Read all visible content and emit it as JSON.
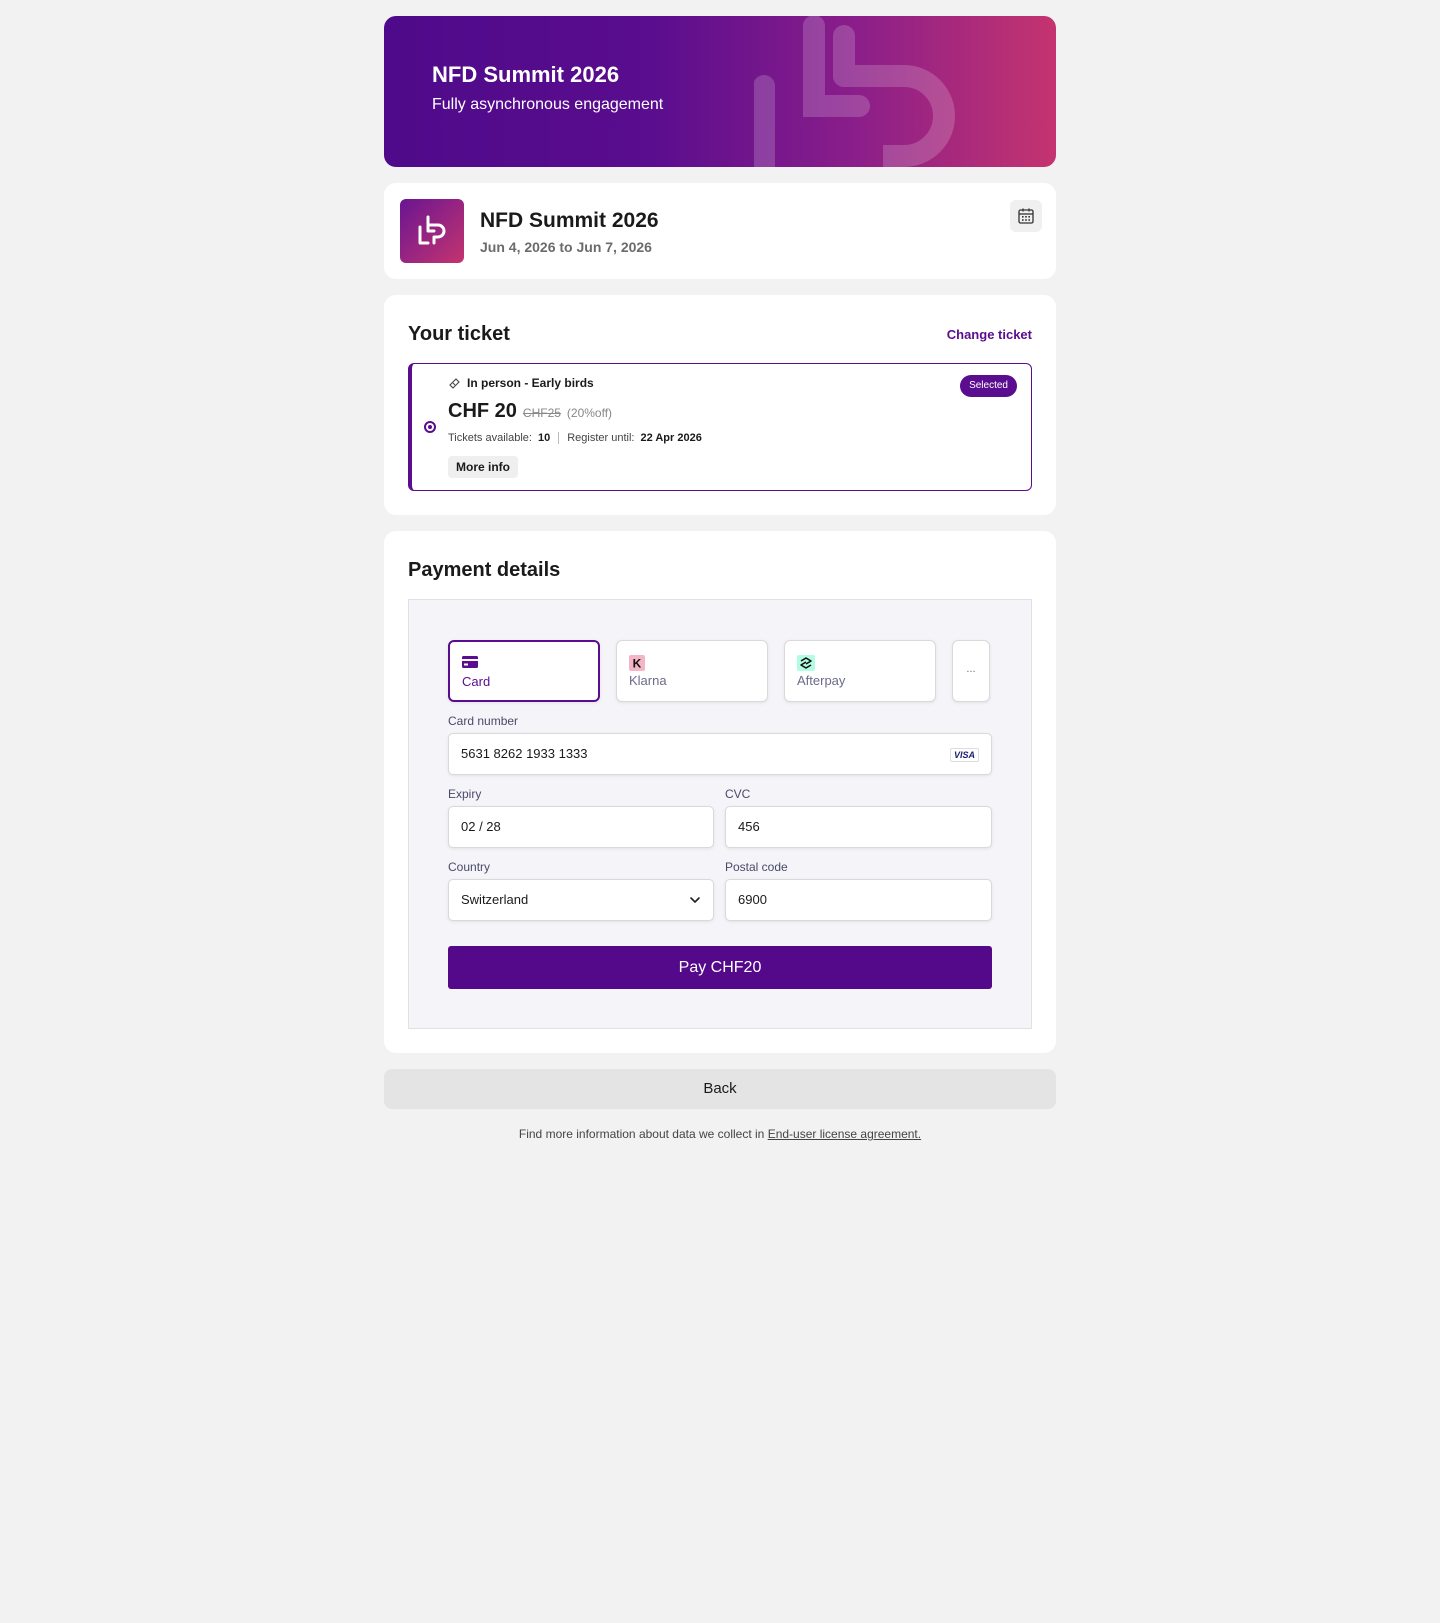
{
  "hero": {
    "title": "NFD Summit 2026",
    "subtitle": "Fully asynchronous engagement"
  },
  "event": {
    "title": "NFD Summit 2026",
    "dates": "Jun 4, 2026 to Jun 7, 2026",
    "calendar_icon": "calendar-icon"
  },
  "ticket": {
    "heading": "Your ticket",
    "change_label": "Change ticket",
    "type": "In person - Early birds",
    "badge": "Selected",
    "price": "CHF 20",
    "old_price": "CHF25",
    "discount": "(20%off)",
    "available_label": "Tickets available:",
    "available": "10",
    "register_label": "Register until:",
    "register_date": "22 Apr 2026",
    "more_info": "More info"
  },
  "payment": {
    "heading": "Payment details",
    "methods": [
      {
        "label": "Card",
        "icon": "credit-card-icon"
      },
      {
        "label": "Klarna",
        "icon": "klarna-icon"
      },
      {
        "label": "Afterpay",
        "icon": "afterpay-icon"
      },
      {
        "label": "..."
      }
    ],
    "card_number_label": "Card number",
    "card_number": "5631 8262 1933 1333",
    "card_brand": "VISA",
    "expiry_label": "Expiry",
    "expiry": "02 / 28",
    "cvc_label": "CVC",
    "cvc": "456",
    "country_label": "Country",
    "country": "Switzerland",
    "postal_label": "Postal code",
    "postal": "6900",
    "pay_label": "Pay CHF20"
  },
  "back_label": "Back",
  "footer": {
    "text": "Find more information about data we collect in ",
    "link": "End-user license agreement."
  },
  "colors": {
    "accent": "#5a0d8e",
    "gradient_end": "#c4346f"
  }
}
